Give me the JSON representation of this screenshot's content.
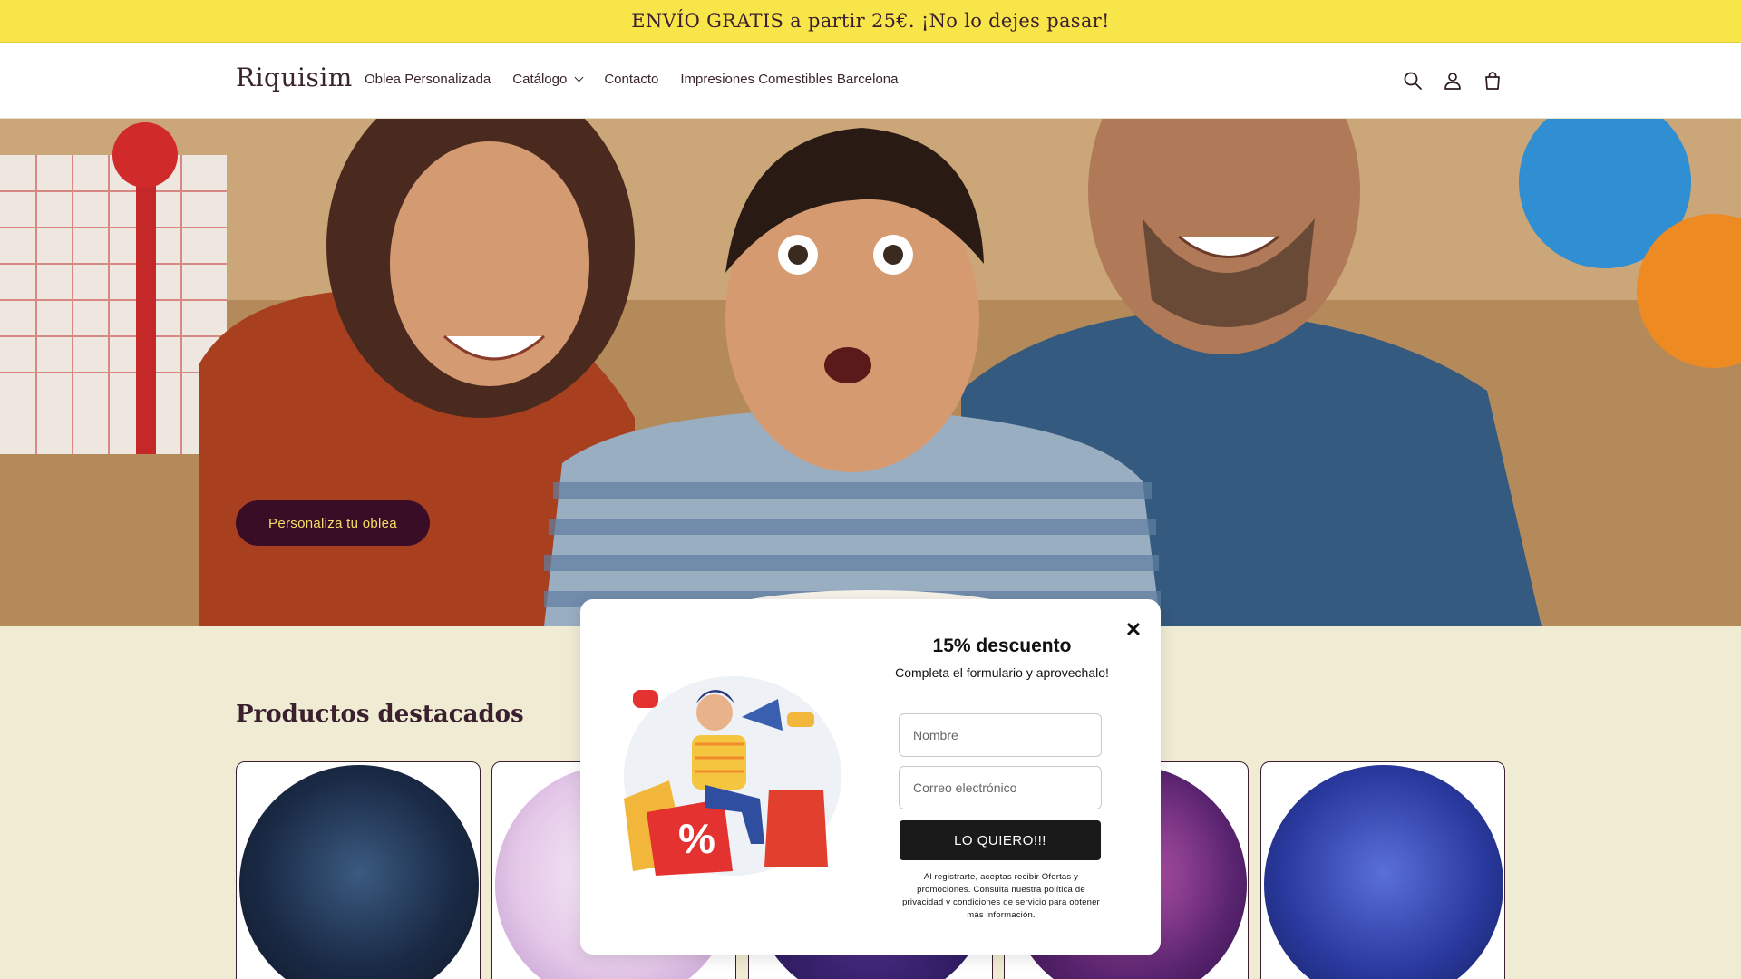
{
  "announcement": "ENVÍO GRATIS a partir 25€. ¡No lo dejes pasar!",
  "header": {
    "logo": "Riquisim",
    "nav": [
      {
        "label": "Oblea Personalizada"
      },
      {
        "label": "Catálogo"
      },
      {
        "label": "Contacto"
      },
      {
        "label": "Impresiones Comestibles Barcelona"
      }
    ],
    "icons": [
      "search-icon",
      "account-icon",
      "cart-icon"
    ]
  },
  "hero": {
    "button_label": "Personaliza tu oblea"
  },
  "featured": {
    "title": "Productos destacados",
    "cards": [
      {
        "name": "card-1"
      },
      {
        "name": "card-2"
      },
      {
        "name": "card-3"
      },
      {
        "name": "card-4"
      },
      {
        "name": "card-5"
      }
    ]
  },
  "popup": {
    "title": "15% descuento",
    "subtitle": "Completa el formulario y aprovechalo!",
    "name_placeholder": "Nombre",
    "email_placeholder": "Correo electrónico",
    "submit_label": "LO QUIERO!!!",
    "legal": "Al registrarte, aceptas recibir Ofertas y promociones. Consulta nuestra política de privacidad y condiciones de servicio para obtener más información.",
    "close_label": "✕"
  },
  "colors": {
    "announcement_bg": "#f8e54a",
    "page_bg": "#f0ecd4",
    "button_bg": "#3a0d26",
    "button_text": "#f6dd6a"
  }
}
